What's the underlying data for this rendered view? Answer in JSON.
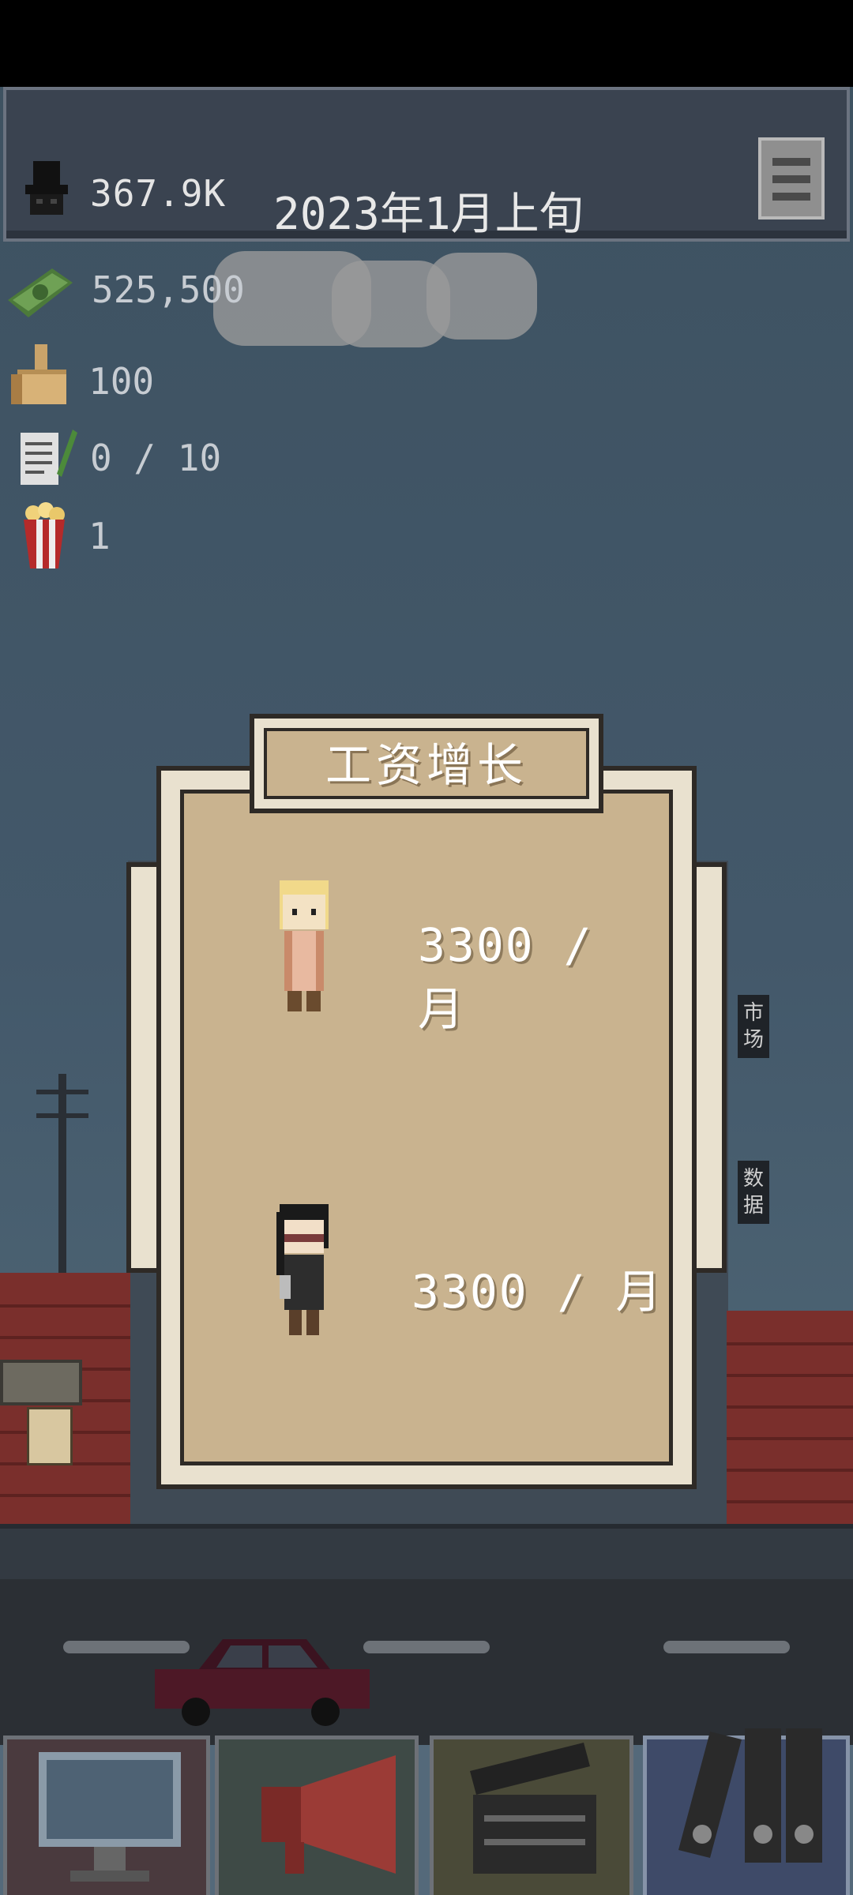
{
  "header": {
    "fans": "367.9K",
    "date": "2023年1月上旬",
    "menu_icon": "hamburger-menu-icon"
  },
  "stats": {
    "money": "525,500",
    "reputation": "100",
    "scripts": "0 / 10",
    "popcorn": "1"
  },
  "side_tabs": {
    "market": "市\n场",
    "data": "数\n据"
  },
  "dialog": {
    "title": "工资增长",
    "employees": [
      {
        "name": "blonde-employee",
        "salary": "3300 / 月"
      },
      {
        "name": "dark-haired-employee",
        "salary": "3300 / 月"
      }
    ]
  },
  "toolbar": {
    "items": [
      "computer-icon",
      "megaphone-icon",
      "clapperboard-icon",
      "binders-icon"
    ]
  },
  "colors": {
    "sky": "#43586a",
    "dialog_paper": "#c9b38f",
    "dialog_border": "#e9e1cf",
    "brick": "#7a2f2c"
  }
}
